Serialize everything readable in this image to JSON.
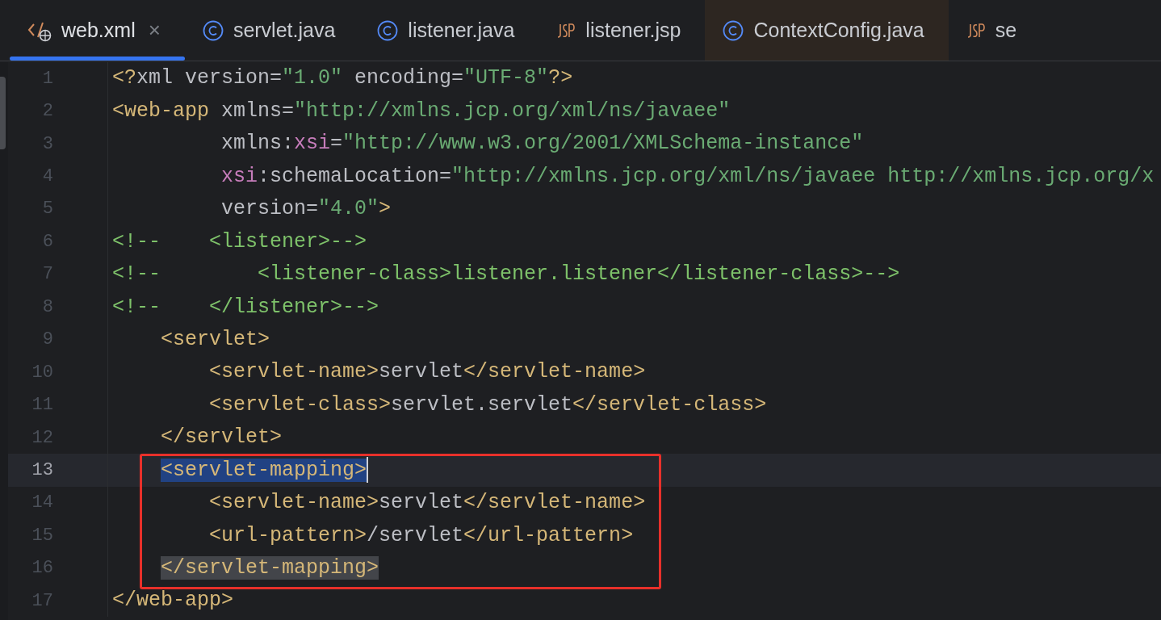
{
  "tabs": [
    {
      "label": "web.xml",
      "kind": "xml",
      "selected": true,
      "closable": true,
      "tinted": false
    },
    {
      "label": "servlet.java",
      "kind": "class",
      "selected": false,
      "closable": false,
      "tinted": false
    },
    {
      "label": "listener.java",
      "kind": "class",
      "selected": false,
      "closable": false,
      "tinted": false
    },
    {
      "label": "listener.jsp",
      "kind": "jsp",
      "selected": false,
      "closable": false,
      "tinted": false
    },
    {
      "label": "ContextConfig.java",
      "kind": "class",
      "selected": false,
      "closable": false,
      "tinted": true
    },
    {
      "label": "se",
      "kind": "jsp",
      "selected": false,
      "closable": false,
      "tinted": false
    }
  ],
  "tab_close": "×",
  "editor": {
    "blocks": [
      {
        "framed": false,
        "lines": [
          {
            "number": "1",
            "current": false,
            "tokens": [
              {
                "t": "<?",
                "kind": "tag"
              },
              {
                "t": "xml version=",
                "kind": "text"
              },
              {
                "t": "\"1.0\"",
                "kind": "string"
              },
              {
                "t": " encoding=",
                "kind": "text"
              },
              {
                "t": "\"UTF-8\"",
                "kind": "string"
              },
              {
                "t": "?>",
                "kind": "tag"
              }
            ]
          },
          {
            "number": "2",
            "current": false,
            "tokens": [
              {
                "t": "<web-app",
                "kind": "tag"
              },
              {
                "t": " xmlns=",
                "kind": "text"
              },
              {
                "t": "\"http://xmlns.jcp.org/xml/ns/javaee\"",
                "kind": "string"
              }
            ]
          },
          {
            "number": "3",
            "current": false,
            "tokens": [
              {
                "t": "         xmlns:",
                "kind": "text"
              },
              {
                "t": "xsi",
                "kind": "ns"
              },
              {
                "t": "=",
                "kind": "text"
              },
              {
                "t": "\"http://www.w3.org/2001/XMLSchema-instance\"",
                "kind": "string"
              }
            ]
          },
          {
            "number": "4",
            "current": false,
            "tokens": [
              {
                "t": "         xsi",
                "kind": "ns"
              },
              {
                "t": ":schemaLocation=",
                "kind": "text"
              },
              {
                "t": "\"http://xmlns.jcp.org/xml/ns/javaee http://xmlns.jcp.org/x",
                "kind": "string"
              }
            ]
          },
          {
            "number": "5",
            "current": false,
            "tokens": [
              {
                "t": "         version=",
                "kind": "text"
              },
              {
                "t": "\"4.0\"",
                "kind": "string"
              },
              {
                "t": ">",
                "kind": "tag"
              }
            ]
          },
          {
            "number": "6",
            "current": false,
            "tokens": [
              {
                "t": "<!--    <listener>-->",
                "kind": "comment"
              }
            ]
          },
          {
            "number": "7",
            "current": false,
            "tokens": [
              {
                "t": "<!--        <listener-class>listener.listener</listener-class>-->",
                "kind": "comment"
              }
            ]
          },
          {
            "number": "8",
            "current": false,
            "tokens": [
              {
                "t": "<!--    </listener>-->",
                "kind": "comment"
              }
            ]
          },
          {
            "number": "9",
            "current": false,
            "tokens": [
              {
                "t": "    <servlet>",
                "kind": "tag"
              }
            ]
          },
          {
            "number": "10",
            "current": false,
            "tokens": [
              {
                "t": "        <servlet-name>",
                "kind": "tag"
              },
              {
                "t": "servlet",
                "kind": "text"
              },
              {
                "t": "</servlet-name>",
                "kind": "tag"
              }
            ]
          },
          {
            "number": "11",
            "current": false,
            "tokens": [
              {
                "t": "        <servlet-class>",
                "kind": "tag"
              },
              {
                "t": "servlet.servlet",
                "kind": "text"
              },
              {
                "t": "</servlet-class>",
                "kind": "tag"
              }
            ]
          },
          {
            "number": "12",
            "current": false,
            "tokens": [
              {
                "t": "    </servlet>",
                "kind": "tag"
              }
            ]
          }
        ]
      },
      {
        "framed": true,
        "lines": [
          {
            "number": "13",
            "current": true,
            "tokens": [
              {
                "t": "    <servlet-mapping>",
                "kind": "tag",
                "selected": true
              }
            ]
          },
          {
            "number": "14",
            "current": false,
            "tokens": [
              {
                "t": "        <servlet-name>",
                "kind": "tag"
              },
              {
                "t": "servlet",
                "kind": "text"
              },
              {
                "t": "</servlet-name>",
                "kind": "tag"
              }
            ]
          },
          {
            "number": "15",
            "current": false,
            "tokens": [
              {
                "t": "        <url-pattern>",
                "kind": "tag"
              },
              {
                "t": "/servlet",
                "kind": "text"
              },
              {
                "t": "</url-pattern>",
                "kind": "tag"
              }
            ]
          },
          {
            "number": "16",
            "current": false,
            "tokens": [
              {
                "t": "    </servlet-mapping>",
                "kind": "tag",
                "matched": true
              }
            ]
          }
        ]
      },
      {
        "framed": false,
        "lines": [
          {
            "number": "17",
            "current": false,
            "tokens": [
              {
                "t": "</web-app>",
                "kind": "tag"
              }
            ]
          }
        ]
      }
    ]
  }
}
